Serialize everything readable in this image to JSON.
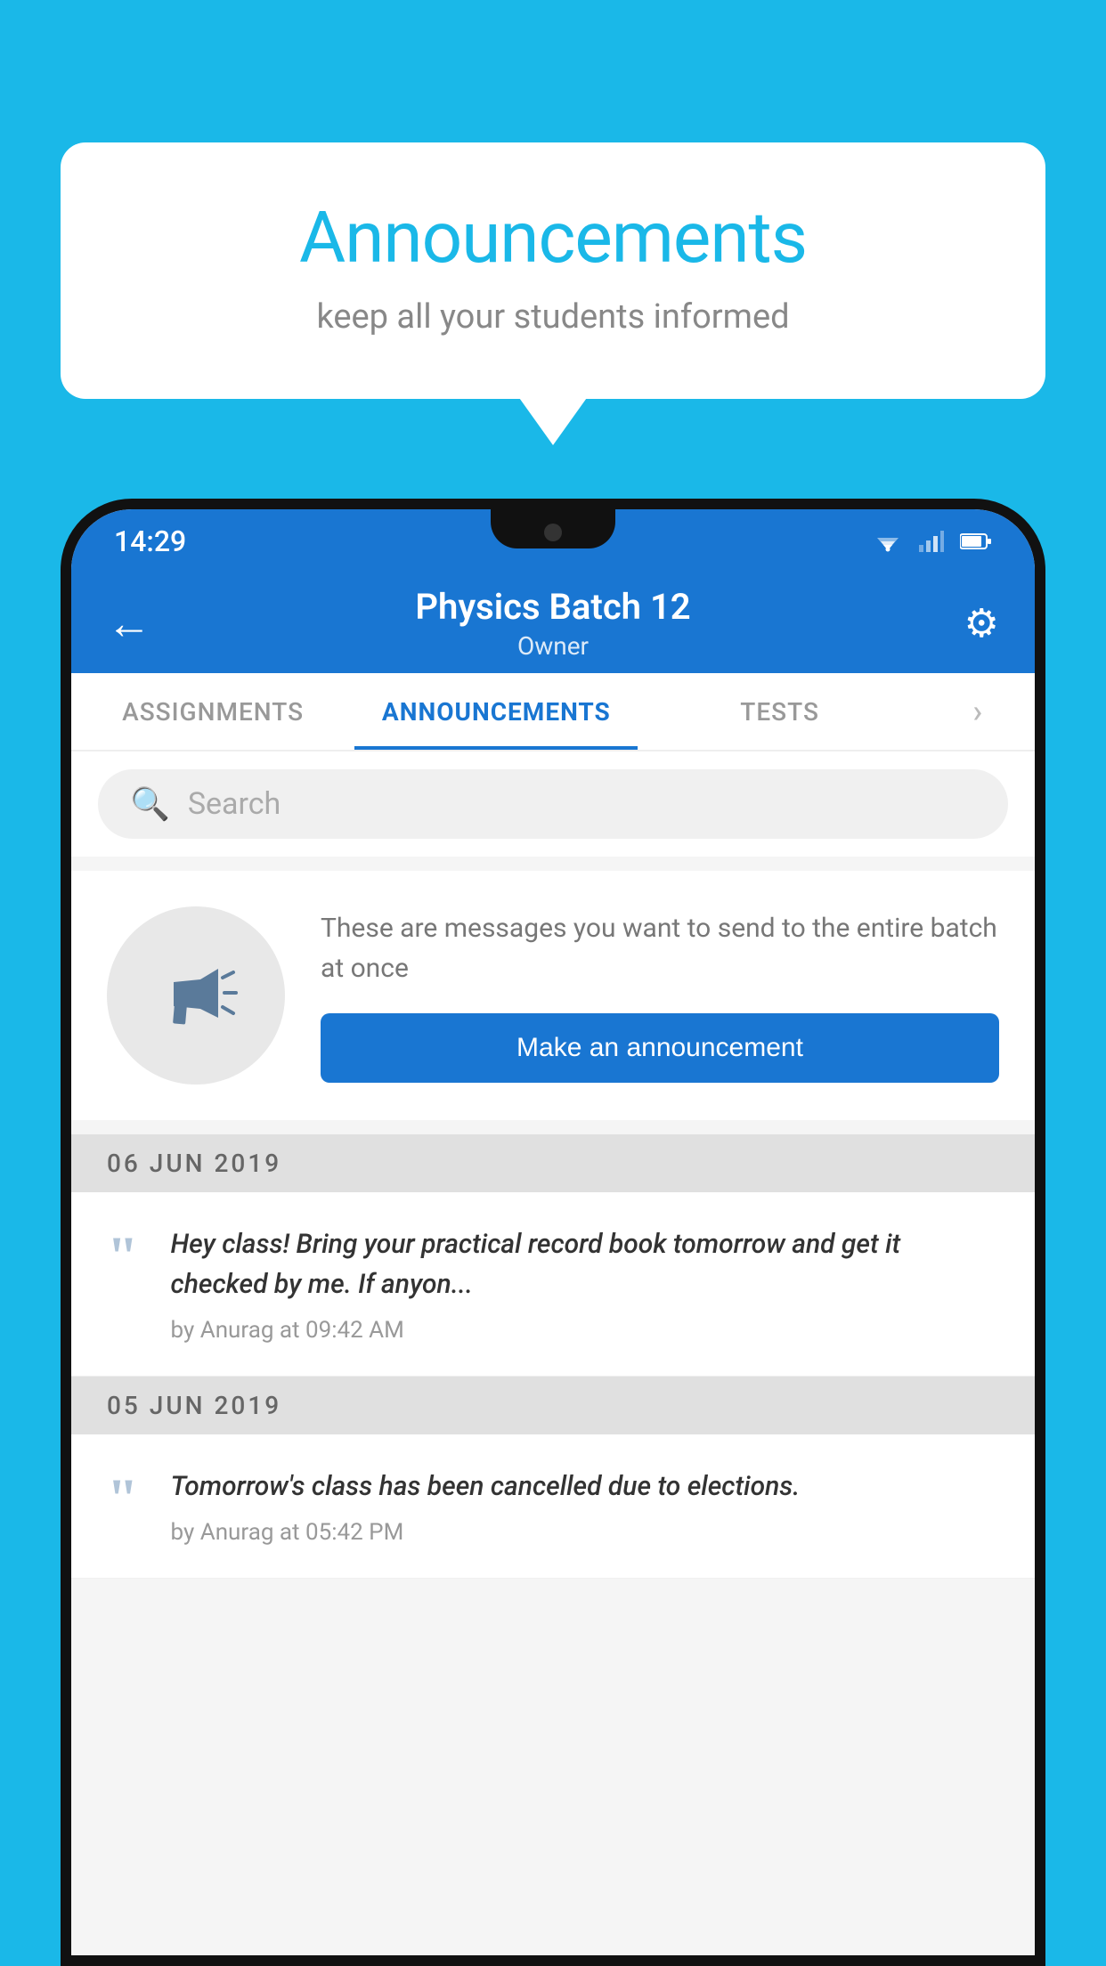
{
  "background_color": "#1ab8e8",
  "speech_bubble": {
    "title": "Announcements",
    "subtitle": "keep all your students informed"
  },
  "status_bar": {
    "time": "14:29"
  },
  "app_bar": {
    "title": "Physics Batch 12",
    "subtitle": "Owner",
    "back_label": "←",
    "settings_label": "⚙"
  },
  "tabs": [
    {
      "label": "ASSIGNMENTS",
      "active": false
    },
    {
      "label": "ANNOUNCEMENTS",
      "active": true
    },
    {
      "label": "TESTS",
      "active": false
    },
    {
      "label": "...",
      "active": false
    }
  ],
  "search": {
    "placeholder": "Search"
  },
  "promo": {
    "description": "These are messages you want to send to the entire batch at once",
    "button_label": "Make an announcement"
  },
  "announcements": [
    {
      "date": "06  JUN  2019",
      "text": "Hey class! Bring your practical record book tomorrow and get it checked by me. If anyon...",
      "meta": "by Anurag at 09:42 AM"
    },
    {
      "date": "05  JUN  2019",
      "text": "Tomorrow's class has been cancelled due to elections.",
      "meta": "by Anurag at 05:42 PM"
    }
  ]
}
